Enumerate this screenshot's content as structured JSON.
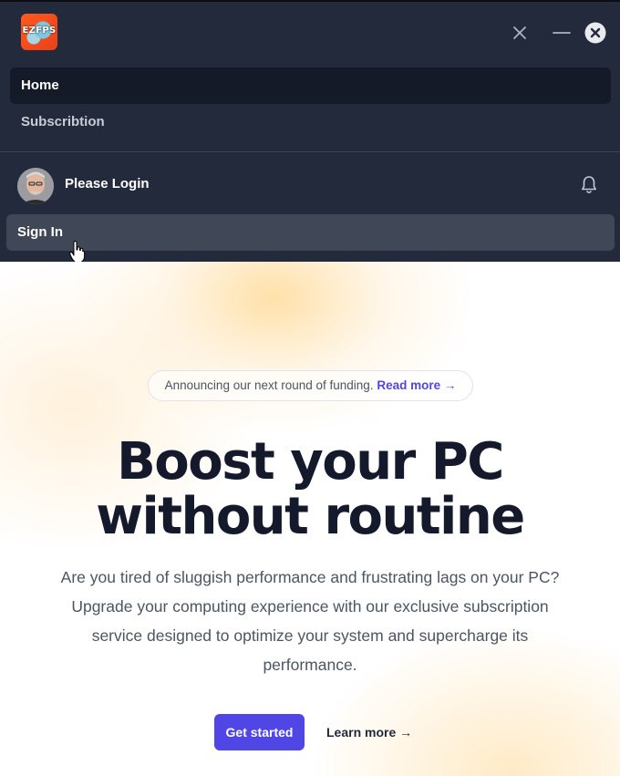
{
  "app": {
    "logo_text": "EZFPS"
  },
  "window_controls": {
    "close_x": "close-icon",
    "minimize": "minimize-icon",
    "close_circle": "close-circle-icon"
  },
  "nav": {
    "items": [
      {
        "label": "Home",
        "active": true
      },
      {
        "label": "Subscribtion",
        "active": false
      }
    ]
  },
  "user": {
    "name": "Please Login",
    "avatar_icon": "avatar",
    "notification_icon": "bell-icon"
  },
  "auth": {
    "signin_label": "Sign In"
  },
  "hero": {
    "announcement_text": "Announcing our next round of funding.",
    "announcement_link": "Read more →",
    "headline_line1": "Boost your PC",
    "headline_line2": "without routine",
    "description": "Are you tired of sluggish performance and frustrating lags on your PC? Upgrade your computing experience with our exclusive subscription service designed to optimize your system and supercharge its performance.",
    "primary_cta": "Get started",
    "secondary_cta": "Learn more →"
  },
  "colors": {
    "panel_bg": "#232a3b",
    "active_nav_bg": "#141a27",
    "signin_bg": "#404858",
    "accent": "#5046e5",
    "headline": "#141a2b"
  }
}
